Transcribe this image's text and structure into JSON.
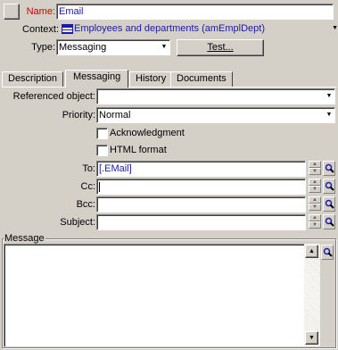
{
  "header": {
    "name_label": "Name:",
    "name_value": "Email",
    "context_label": "Context:",
    "context_value": "Employees and departments (amEmplDept)",
    "type_label": "Type:",
    "type_value": "Messaging",
    "test_button": "Test..."
  },
  "tabs": [
    {
      "label": "Description"
    },
    {
      "label": "Messaging"
    },
    {
      "label": "History"
    },
    {
      "label": "Documents"
    }
  ],
  "messaging": {
    "referenced_object_label": "Referenced object:",
    "referenced_object_value": "",
    "priority_label": "Priority:",
    "priority_value": "Normal",
    "acknowledgment_label": "Acknowledgment",
    "html_format_label": "HTML format",
    "to_label": "To:",
    "to_value": "[.EMail]",
    "cc_label": "Cc:",
    "cc_value": "",
    "bcc_label": "Bcc:",
    "bcc_value": "",
    "subject_label": "Subject:",
    "subject_value": "",
    "message_label": "Message",
    "message_value": ""
  },
  "colors": {
    "background": "#d4d0c8",
    "name_label": "#cc0000",
    "field_text": "#1a1aa6"
  }
}
